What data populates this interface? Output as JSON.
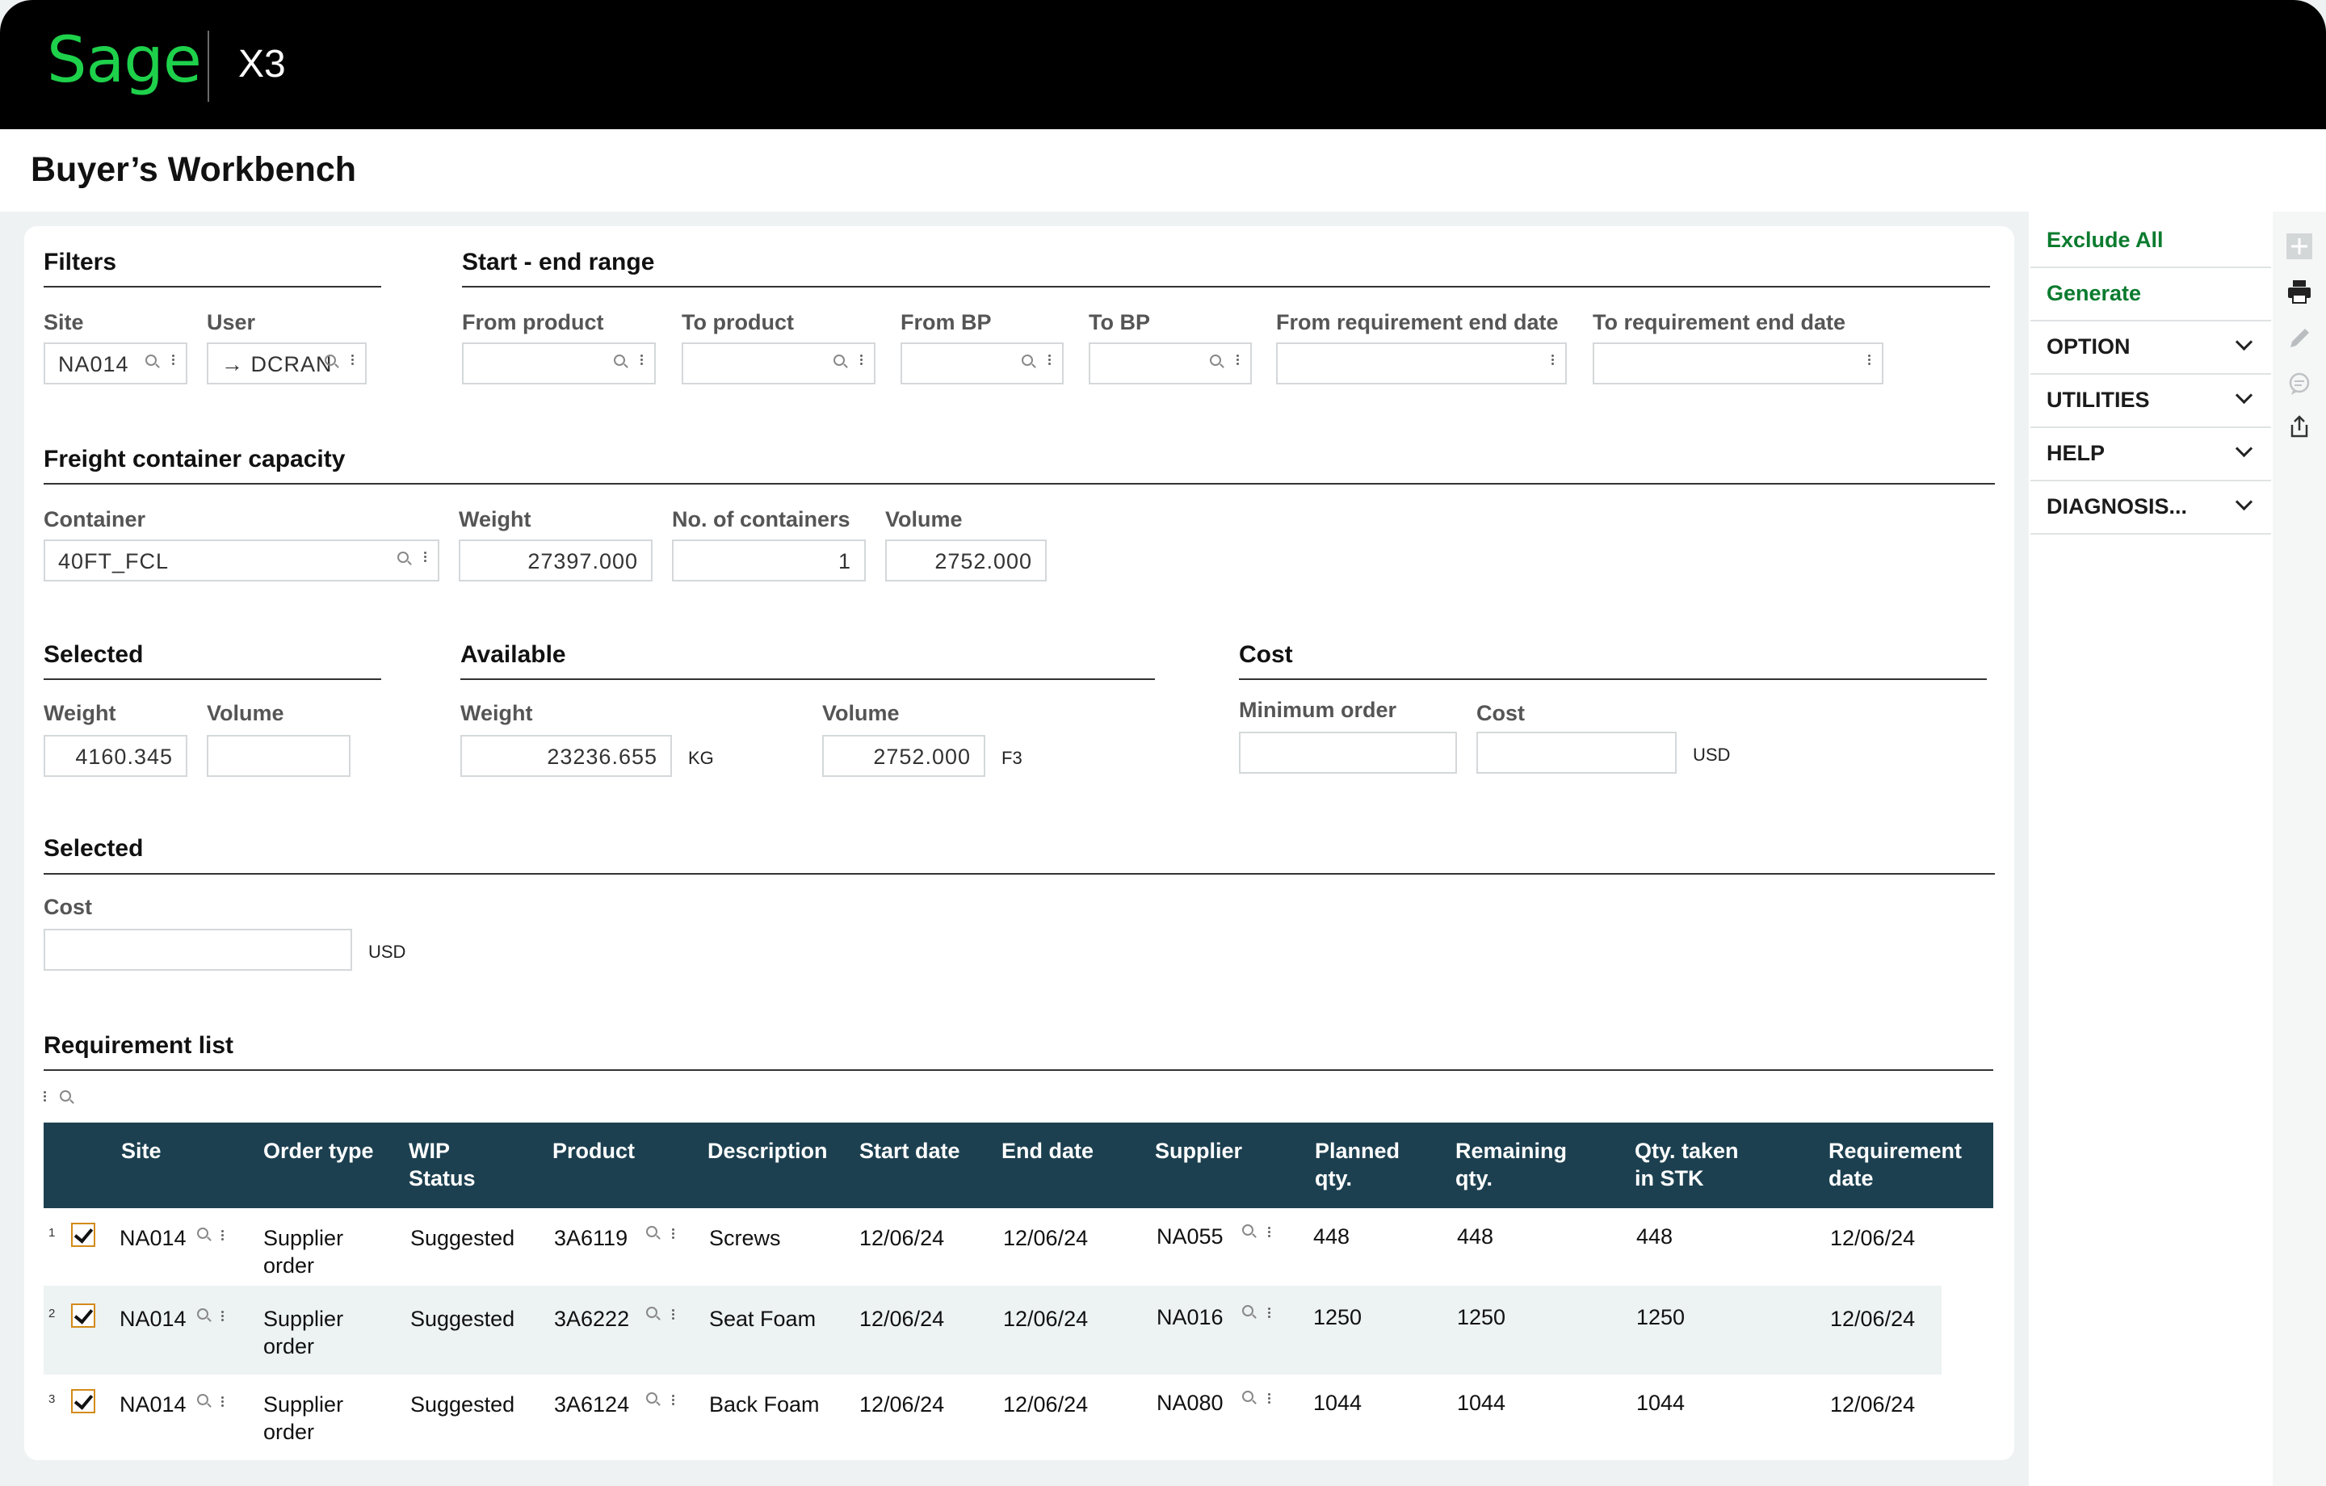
{
  "app": {
    "logo": "Sage",
    "product": "X3",
    "page_title": "Buyer’s Workbench"
  },
  "filters": {
    "title": "Filters",
    "site_label": "Site",
    "site_value": "NA014",
    "user_label": "User",
    "user_value": "→ DCRAN"
  },
  "range": {
    "title": "Start - end range",
    "from_product": "From product",
    "to_product": "To product",
    "from_bp": "From BP",
    "to_bp": "To BP",
    "from_req_end": "From requirement end date",
    "to_req_end": "To requirement end date"
  },
  "freight": {
    "title": "Freight container capacity",
    "container_label": "Container",
    "container_value": "40FT_FCL",
    "weight_label": "Weight",
    "weight_value": "27397.000",
    "containers_label": "No. of containers",
    "containers_value": "1",
    "volume_label": "Volume",
    "volume_value": "2752.000"
  },
  "selected": {
    "title": "Selected",
    "weight_label": "Weight",
    "weight_value": "4160.345",
    "volume_label": "Volume",
    "volume_value": ""
  },
  "available": {
    "title": "Available",
    "weight_label": "Weight",
    "weight_value": "23236.655",
    "weight_unit": "KG",
    "volume_label": "Volume",
    "volume_value": "2752.000",
    "volume_unit": "F3"
  },
  "cost": {
    "title": "Cost",
    "min_order_label": "Minimum order",
    "cost_label": "Cost",
    "currency": "USD"
  },
  "selected_cost": {
    "title": "Selected",
    "cost_label": "Cost",
    "currency": "USD"
  },
  "requirements": {
    "title": "Requirement list",
    "columns": {
      "site": "Site",
      "order_type": "Order type",
      "wip1": "WIP",
      "wip2": "Status",
      "product": "Product",
      "description": "Description",
      "start": "Start date",
      "end": "End date",
      "supplier": "Supplier",
      "planned1": "Planned",
      "planned2": "qty.",
      "remaining1": "Remaining",
      "remaining2": "qty.",
      "taken1": "Qty. taken",
      "taken2": "in STK",
      "reqdate1": "Requirement",
      "reqdate2": "date"
    },
    "rows": [
      {
        "num": "1",
        "site": "NA014",
        "order1": "Supplier",
        "order2": "order",
        "wip": "Suggested",
        "product": "3A6119",
        "description": "Screws",
        "start": "12/06/24",
        "end": "12/06/24",
        "supplier": "NA055",
        "planned": "448",
        "remaining": "448",
        "taken": "448",
        "reqdate": "12/06/24"
      },
      {
        "num": "2",
        "site": "NA014",
        "order1": "Supplier",
        "order2": "order",
        "wip": "Suggested",
        "product": "3A6222",
        "description": "Seat Foam",
        "start": "12/06/24",
        "end": "12/06/24",
        "supplier": "NA016",
        "planned": "1250",
        "remaining": "1250",
        "taken": "1250",
        "reqdate": "12/06/24"
      },
      {
        "num": "3",
        "site": "NA014",
        "order1": "Supplier",
        "order2": "order",
        "wip": "Suggested",
        "product": "3A6124",
        "description": "Back Foam",
        "start": "12/06/24",
        "end": "12/06/24",
        "supplier": "NA080",
        "planned": "1044",
        "remaining": "1044",
        "taken": "1044",
        "reqdate": "12/06/24"
      }
    ]
  },
  "sidebar": {
    "exclude_all": "Exclude All",
    "generate": "Generate",
    "option": "OPTION",
    "utilities": "UTILITIES",
    "help": "HELP",
    "diagnosis": "DIAGNOSIS..."
  },
  "colors": {
    "brand_green": "#1ed14b",
    "grid_header": "#1c4050",
    "action_green": "#0b7b2f",
    "checkbox_border": "#d38a18"
  }
}
